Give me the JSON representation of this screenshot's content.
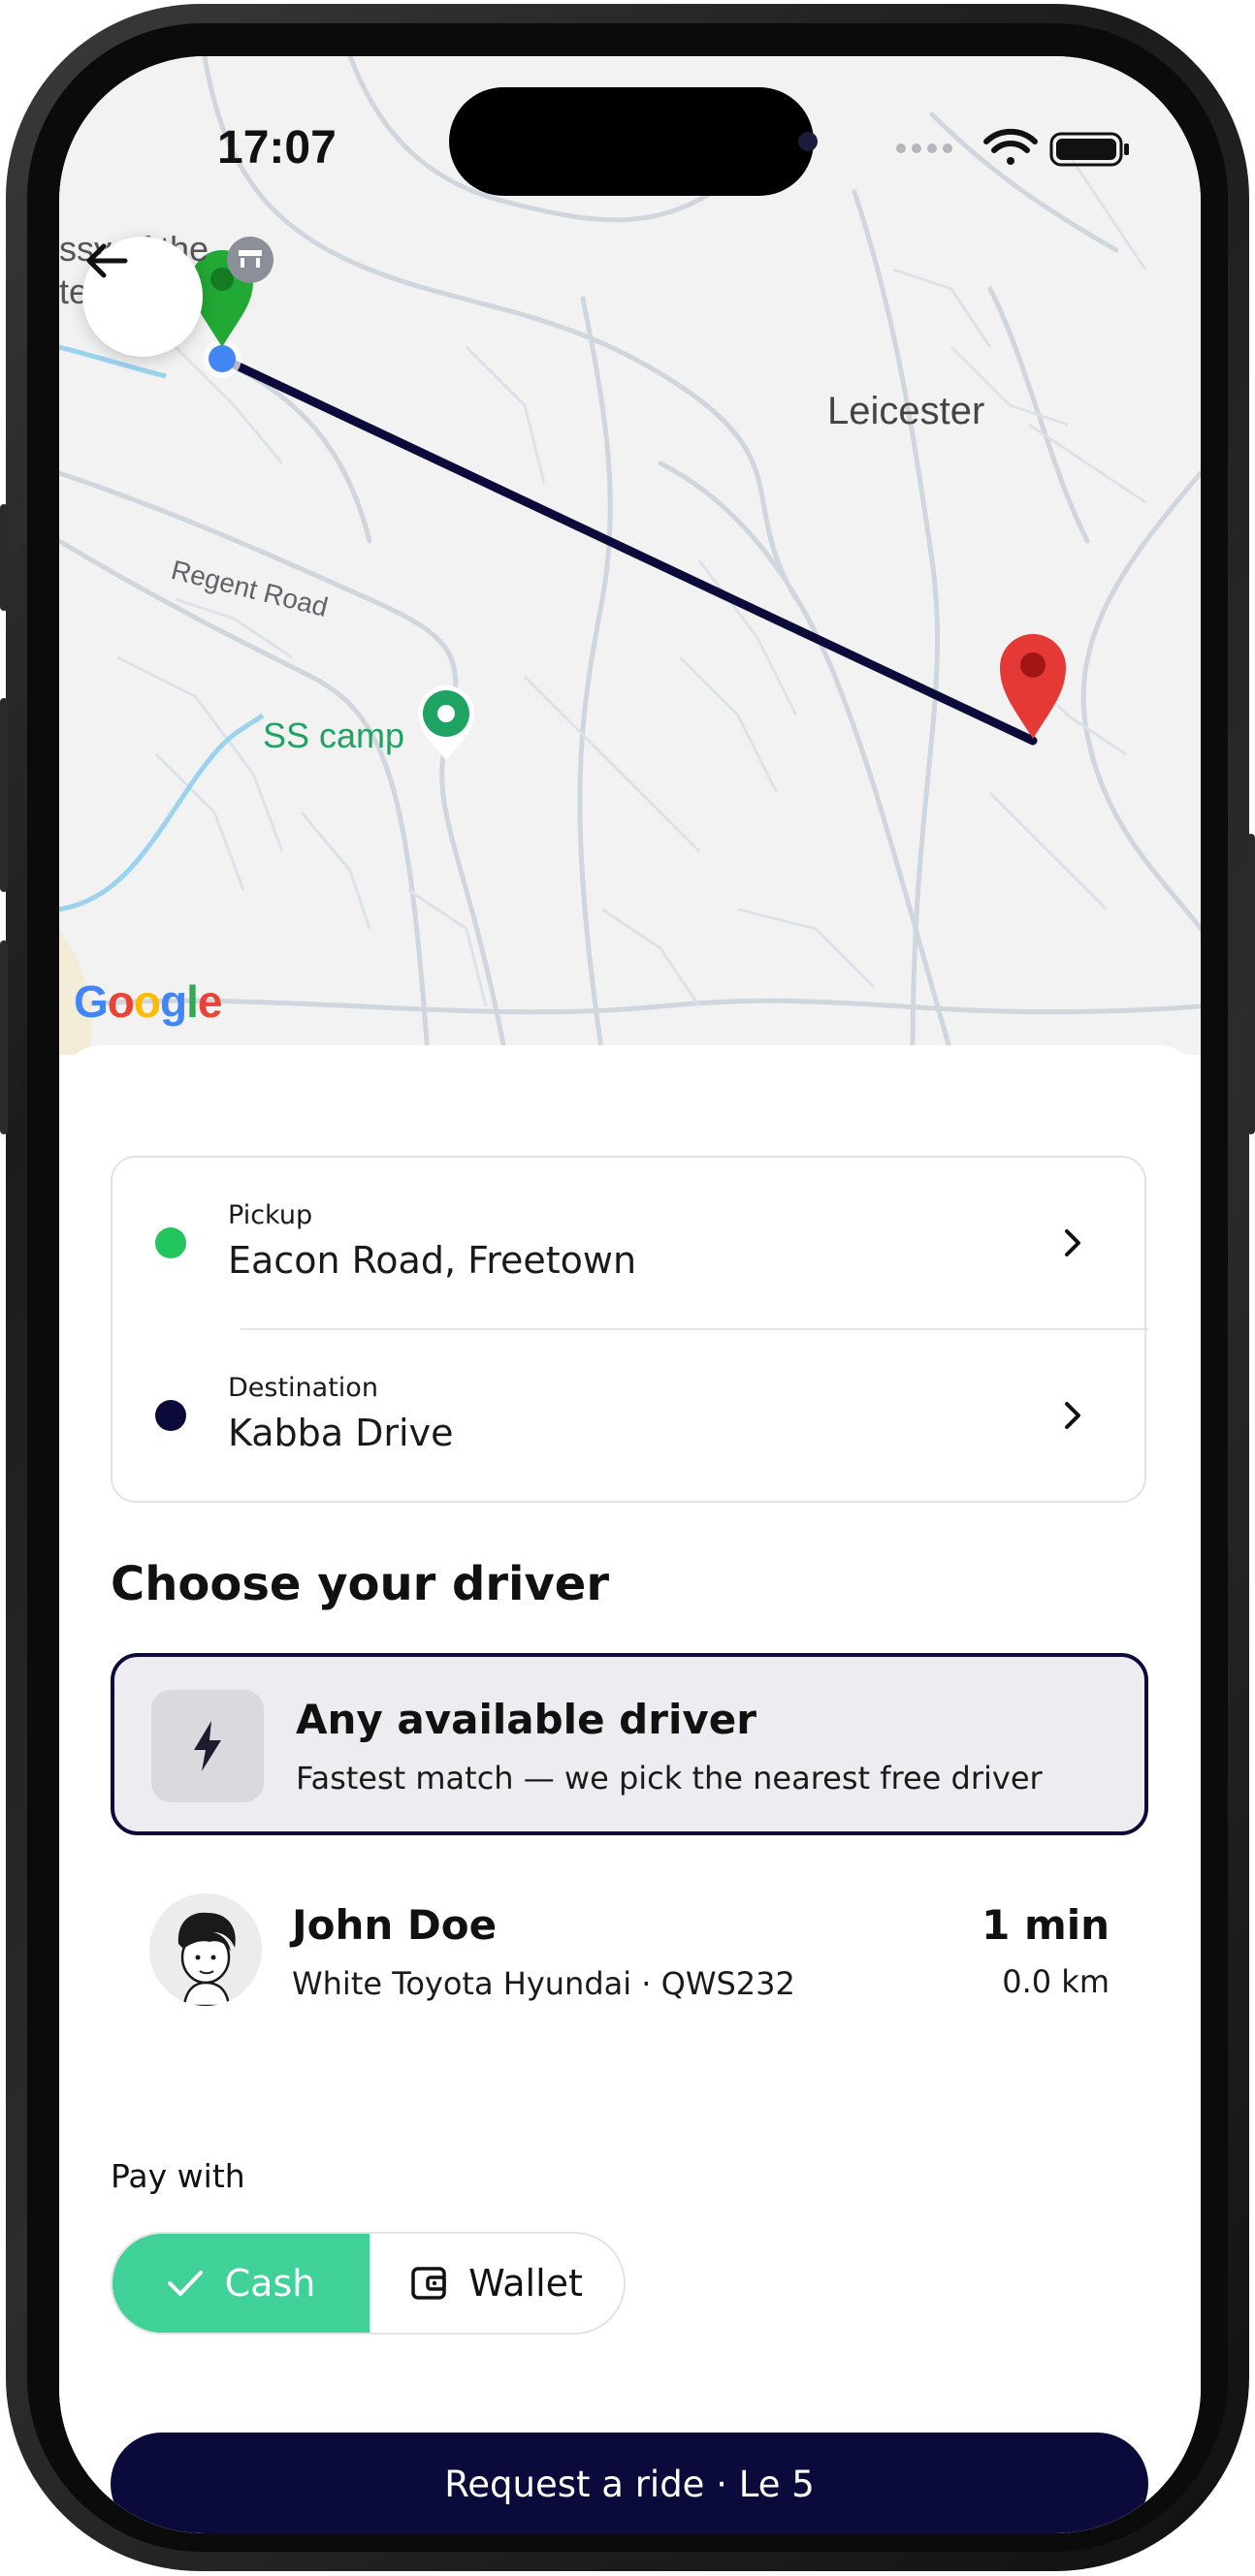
{
  "status_bar": {
    "time": "17:07"
  },
  "map": {
    "labels": {
      "city": "Leicester",
      "road": "Regent Road",
      "poi": "SS camp",
      "edge_top": "ssy of the",
      "edge_bottom": "te"
    },
    "logo": [
      "G",
      "o",
      "o",
      "g",
      "l",
      "e"
    ],
    "logo_colors": [
      "#4285F4",
      "#EA4335",
      "#FBBC05",
      "#4285F4",
      "#34A853",
      "#EA4335"
    ],
    "route_color": "#0b0b3b",
    "pickup_pin_color": "#22a834",
    "destination_pin_color": "#e53935"
  },
  "locations": {
    "pickup": {
      "label": "Pickup",
      "value": "Eacon Road, Freetown",
      "dot_color": "#22c55e"
    },
    "destination": {
      "label": "Destination",
      "value": "Kabba Drive",
      "dot_color": "#0b0b3b"
    }
  },
  "drivers": {
    "title": "Choose your driver",
    "any": {
      "title": "Any available driver",
      "subtitle": "Fastest match — we pick the nearest free driver"
    },
    "list": [
      {
        "name": "John Doe",
        "vehicle": "White Toyota Hyundai · QWS232",
        "eta": "1 min",
        "distance": "0.0 km"
      }
    ]
  },
  "payment": {
    "label": "Pay with",
    "options": [
      "Cash",
      "Wallet"
    ],
    "selected": "Cash",
    "accent": "#3fd198"
  },
  "cta": {
    "label": "Request a ride · Le 5",
    "color": "#0b0b3b"
  }
}
